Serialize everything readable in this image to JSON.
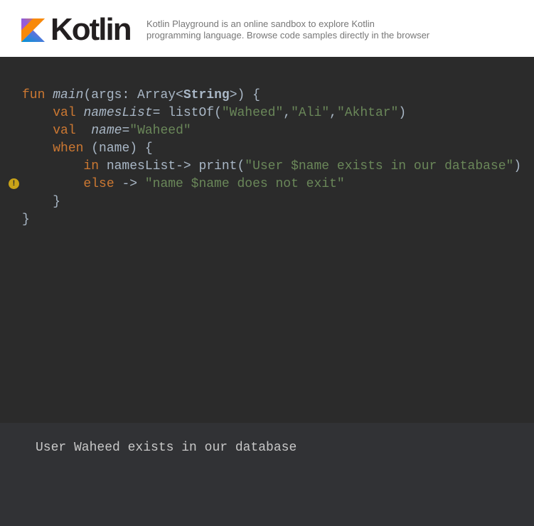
{
  "header": {
    "logo_text": "Kotlin",
    "tagline_line1": "Kotlin Playground is an online sandbox to explore Kotlin",
    "tagline_line2": "programming language. Browse code samples directly in the browser"
  },
  "editor": {
    "warning_icon": "!",
    "lines": [
      [
        {
          "t": "fun ",
          "c": "kw"
        },
        {
          "t": "main",
          "c": "it"
        },
        {
          "t": "(args: Array<",
          "c": ""
        },
        {
          "t": "String",
          "c": "bold"
        },
        {
          "t": ">) {",
          "c": ""
        }
      ],
      [
        {
          "t": "    ",
          "c": ""
        },
        {
          "t": "val ",
          "c": "kw"
        },
        {
          "t": "namesList",
          "c": "it"
        },
        {
          "t": "= listOf(",
          "c": ""
        },
        {
          "t": "\"Waheed\"",
          "c": "str"
        },
        {
          "t": ",",
          "c": ""
        },
        {
          "t": "\"Ali\"",
          "c": "str"
        },
        {
          "t": ",",
          "c": ""
        },
        {
          "t": "\"Akhtar\"",
          "c": "str"
        },
        {
          "t": ")",
          "c": ""
        }
      ],
      [
        {
          "t": "    ",
          "c": ""
        },
        {
          "t": "val  ",
          "c": "kw"
        },
        {
          "t": "name",
          "c": "it"
        },
        {
          "t": "=",
          "c": ""
        },
        {
          "t": "\"Waheed\"",
          "c": "str"
        }
      ],
      [
        {
          "t": "    ",
          "c": ""
        },
        {
          "t": "when ",
          "c": "kw"
        },
        {
          "t": "(name) {",
          "c": ""
        }
      ],
      [
        {
          "t": "        ",
          "c": ""
        },
        {
          "t": "in ",
          "c": "kw"
        },
        {
          "t": "namesList-> print(",
          "c": ""
        },
        {
          "t": "\"User $name exists in our database\"",
          "c": "str"
        },
        {
          "t": ")",
          "c": ""
        }
      ],
      [
        {
          "t": "        ",
          "c": ""
        },
        {
          "t": "else ",
          "c": "kw"
        },
        {
          "t": "-> ",
          "c": ""
        },
        {
          "t": "\"name $name does not exit\"",
          "c": "str"
        }
      ],
      [
        {
          "t": "    }",
          "c": ""
        }
      ],
      [
        {
          "t": "}",
          "c": ""
        }
      ]
    ]
  },
  "output": {
    "text": "User Waheed exists in our database"
  },
  "colors": {
    "keyword": "#cc7832",
    "string": "#6a8759",
    "text": "#a9b7c6",
    "editor_bg": "#2b2b2b",
    "output_bg": "#313235"
  }
}
